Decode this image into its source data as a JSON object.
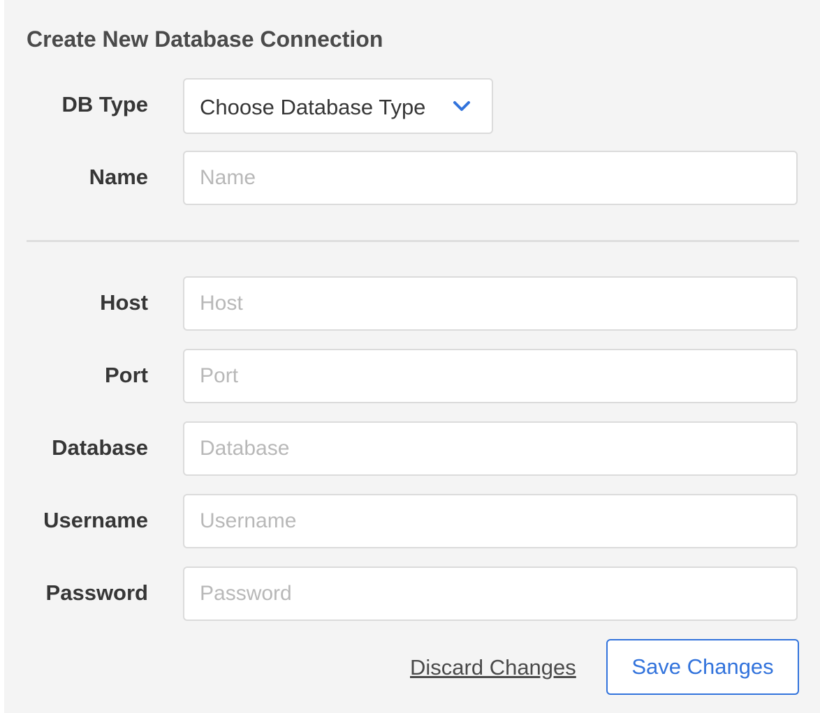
{
  "form": {
    "title": "Create New Database Connection",
    "db_type": {
      "label": "DB Type",
      "selected": "Choose Database Type"
    },
    "name": {
      "label": "Name",
      "value": "",
      "placeholder": "Name"
    },
    "host": {
      "label": "Host",
      "value": "",
      "placeholder": "Host"
    },
    "port": {
      "label": "Port",
      "value": "",
      "placeholder": "Port"
    },
    "database": {
      "label": "Database",
      "value": "",
      "placeholder": "Database"
    },
    "username": {
      "label": "Username",
      "value": "",
      "placeholder": "Username"
    },
    "password": {
      "label": "Password",
      "value": "",
      "placeholder": "Password"
    }
  },
  "actions": {
    "discard_label": "Discard Changes",
    "save_label": "Save Changes"
  },
  "colors": {
    "accent": "#3273dc",
    "panel_background": "#f4f4f4",
    "input_border": "#dbdbdb",
    "placeholder": "#b8b8b8",
    "label_text": "#363636"
  },
  "icons": {
    "select_chevron": "chevron-down-icon"
  }
}
